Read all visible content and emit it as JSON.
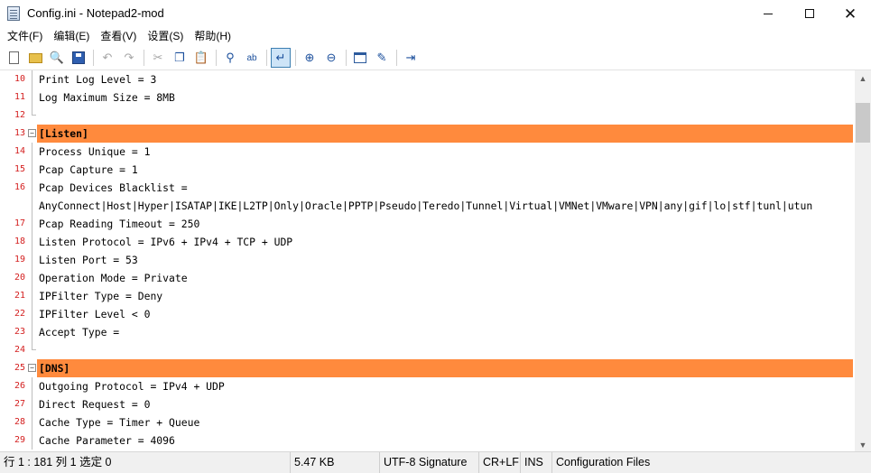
{
  "window": {
    "title": "Config.ini - Notepad2-mod",
    "app_icon": "notepad-icon",
    "controls": [
      "minimize-icon",
      "maximize-icon",
      "close-icon"
    ]
  },
  "menu": [
    "文件(F)",
    "编辑(E)",
    "查看(V)",
    "设置(S)",
    "帮助(H)"
  ],
  "toolbar": {
    "buttons": [
      "new-file-icon",
      "open-file-icon",
      "browse-icon",
      "save-icon",
      "undo-icon",
      "redo-icon",
      "cut-icon",
      "copy-icon",
      "paste-icon",
      "find-icon",
      "replace-icon",
      "word-wrap-icon",
      "zoom-in-icon",
      "zoom-out-icon",
      "scheme-icon",
      "customize-icon",
      "exit-icon"
    ]
  },
  "editor": {
    "lines": [
      {
        "num": "10",
        "text": "Print Log Level = 3"
      },
      {
        "num": "11",
        "text": "Log Maximum Size = 8MB"
      },
      {
        "num": "12",
        "text": ""
      },
      {
        "num": "13",
        "text": "[Listen]",
        "section": true
      },
      {
        "num": "14",
        "text": "Process Unique = 1"
      },
      {
        "num": "15",
        "text": "Pcap Capture = 1"
      },
      {
        "num": "16",
        "text": "Pcap Devices Blacklist ="
      },
      {
        "num": "",
        "text": "AnyConnect|Host|Hyper|ISATAP|IKE|L2TP|Only|Oracle|PPTP|Pseudo|Teredo|Tunnel|Virtual|VMNet|VMware|VPN|any|gif|lo|stf|tunl|utun"
      },
      {
        "num": "17",
        "text": "Pcap Reading Timeout = 250"
      },
      {
        "num": "18",
        "text": "Listen Protocol = IPv6 + IPv4 + TCP + UDP"
      },
      {
        "num": "19",
        "text": "Listen Port = 53"
      },
      {
        "num": "20",
        "text": "Operation Mode = Private"
      },
      {
        "num": "21",
        "text": "IPFilter Type = Deny"
      },
      {
        "num": "22",
        "text": "IPFilter Level < 0"
      },
      {
        "num": "23",
        "text": "Accept Type ="
      },
      {
        "num": "24",
        "text": ""
      },
      {
        "num": "25",
        "text": "[DNS]",
        "section": true
      },
      {
        "num": "26",
        "text": "Outgoing Protocol = IPv4 + UDP"
      },
      {
        "num": "27",
        "text": "Direct Request = 0"
      },
      {
        "num": "28",
        "text": "Cache Type = Timer + Queue"
      },
      {
        "num": "29",
        "text": "Cache Parameter = 4096"
      }
    ],
    "section_color": "#ff8a3d",
    "line_number_color": "#d42020"
  },
  "status": {
    "position": "行 1 : 181   列 1   选定 0",
    "size": "5.47 KB",
    "encoding": "UTF-8 Signature",
    "eol": "CR+LF",
    "mode": "INS",
    "scheme": "Configuration Files"
  }
}
